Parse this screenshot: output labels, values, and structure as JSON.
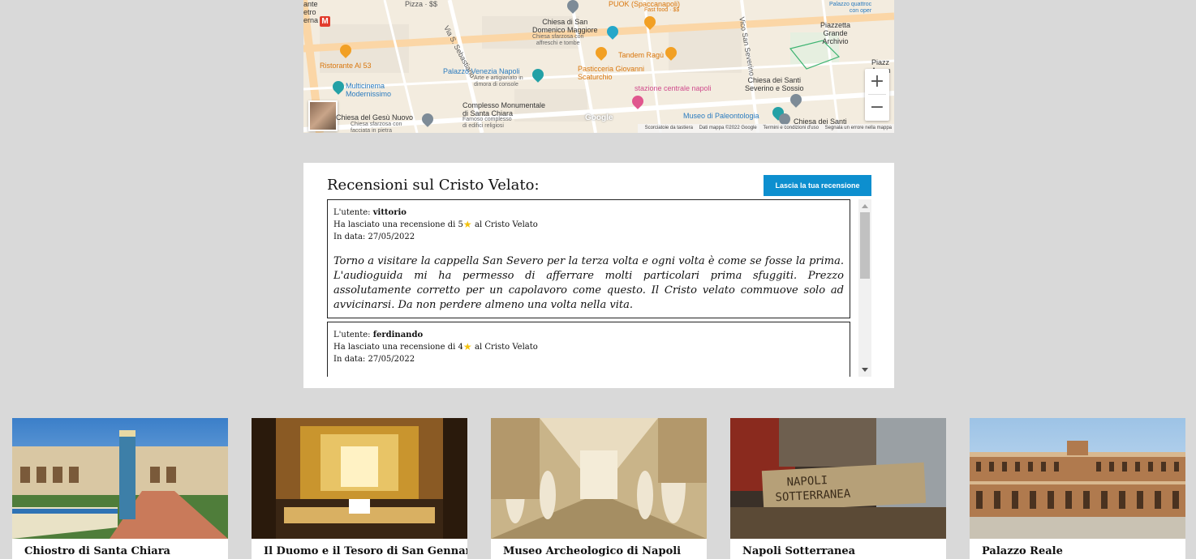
{
  "map": {
    "labels": {
      "dante": "ante\netro\nerna",
      "ristorante": "Ristorante Al 53",
      "multicinema": "Multicinema\nModernissimo",
      "gesu": "Chiesa del Gesù Nuovo",
      "gesu_sub": "Chiesa sfarzosa con\nfacciata in pietra",
      "palazzo_venezia": "Palazzo Venezia Napoli",
      "palazzo_venezia_sub": "Arte e artigianato in\ndimora di console",
      "santa_chiara": "Complesso Monumentale\ndi Santa Chiara",
      "santa_chiara_sub": "Famoso complesso\ndi edifici religiosi",
      "pizza": "Pizza · $$",
      "via_sebastiano": "Via S. Sebastiano",
      "domenico": "Chiesa di San\nDomenico Maggiore",
      "domenico_sub": "Chiesa sfarzosa con\naffreschi e tombe",
      "puok": "PUOK (Spaccanapoli)",
      "puok_sub": "Fast food · $$",
      "tandem": "Tandem Ragù",
      "pasticceria": "Pasticceria Giovanni\nScaturchio",
      "stazione": "stazione centrale napoli",
      "vico": "Vico San Severino",
      "severino": "Chiesa dei Santi\nSeverino e Sossio",
      "museo_paleo": "Museo di Paleontologia",
      "chiesa_santi": "Chiesa dei Santi",
      "piazzetta": "Piazzetta\nGrande\nArchivio",
      "palazzo_top": "Palazzo quattroc\ncon oper",
      "piazz": "Piazz\nArcan",
      "google": "Google"
    },
    "zoom_in": "+",
    "zoom_out": "−",
    "attribution": {
      "shortcuts": "Scorciatoie da tastiera",
      "data": "Dati mappa ©2022 Google",
      "terms": "Termini e condizioni d'uso",
      "report": "Segnala un errore nella mappa"
    }
  },
  "reviews": {
    "heading": "Recensioni sul Cristo Velato:",
    "button_label": "Lascia la tua recensione",
    "items": [
      {
        "user_prefix": "L'utente: ",
        "user": "vittorio",
        "rating_prefix": "Ha lasciato una recensione di ",
        "rating": "5",
        "rating_suffix": " al Cristo Velato",
        "date_prefix": "In data: ",
        "date": "27/05/2022",
        "text": "Torno a visitare la cappella San Severo per la terza volta e ogni volta è come se fosse la prima. L'audioguida mi ha permesso di afferrare molti particolari prima sfuggiti. Prezzo assolutamente corretto per un capolavoro come questo. Il Cristo velato commuove solo ad avvicinarsi. Da non perdere almeno una volta nella vita."
      },
      {
        "user_prefix": "L'utente: ",
        "user": "ferdinando",
        "rating_prefix": "Ha lasciato una recensione di ",
        "rating": "4",
        "rating_suffix": " al Cristo Velato",
        "date_prefix": "In data: ",
        "date": "27/05/2022",
        "text": ""
      }
    ]
  },
  "places": [
    {
      "title": "Chiostro di Santa Chiara"
    },
    {
      "title": "Il Duomo e il Tesoro di San Gennaro"
    },
    {
      "title": "Museo Archeologico di Napoli"
    },
    {
      "title": "Napoli Sotterranea"
    },
    {
      "title": "Palazzo Reale"
    }
  ],
  "colors": {
    "page_bg": "#d9d9d9",
    "button_bg": "#0d8fcf",
    "star": "#f4c20d"
  }
}
